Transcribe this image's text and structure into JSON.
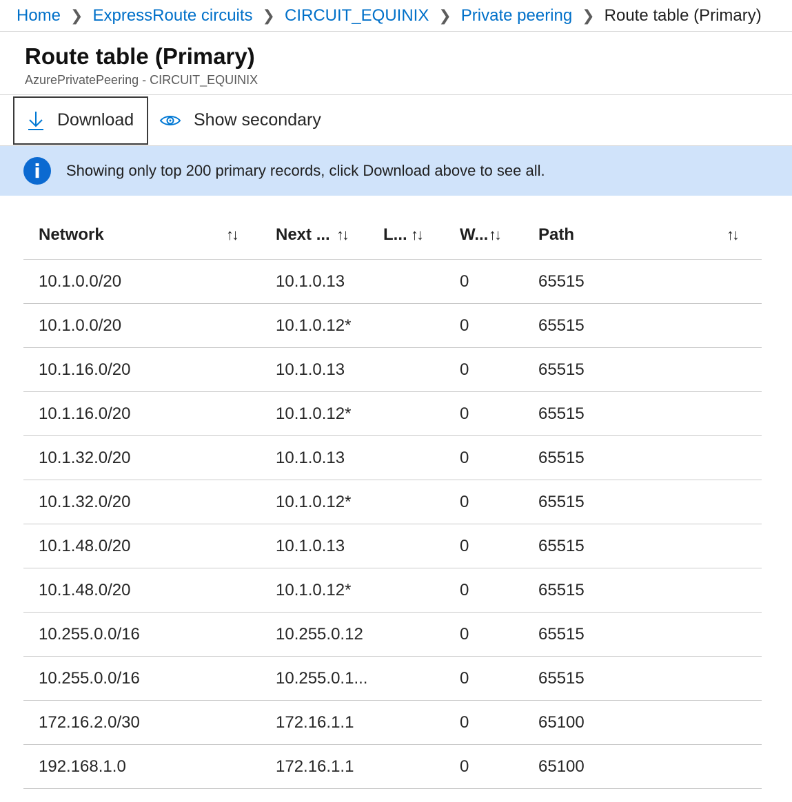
{
  "breadcrumb": {
    "items": [
      "Home",
      "ExpressRoute circuits",
      "CIRCUIT_EQUINIX",
      "Private peering"
    ],
    "current": "Route table (Primary)"
  },
  "header": {
    "title": "Route table (Primary)",
    "subtitle": "AzurePrivatePeering - CIRCUIT_EQUINIX"
  },
  "toolbar": {
    "download_label": "Download",
    "show_secondary_label": "Show secondary"
  },
  "infobar": {
    "message": "Showing only top 200 primary records, click Download above to see all."
  },
  "table": {
    "columns": {
      "network": "Network",
      "next_hop": "Next ...",
      "local_pref": "L...",
      "weight": "W...",
      "path": "Path"
    },
    "sort_glyph": "↑↓",
    "rows": [
      {
        "network": "10.1.0.0/20",
        "next_hop": "10.1.0.13",
        "local_pref": "",
        "weight": "0",
        "path": "65515"
      },
      {
        "network": "10.1.0.0/20",
        "next_hop": "10.1.0.12*",
        "local_pref": "",
        "weight": "0",
        "path": "65515"
      },
      {
        "network": "10.1.16.0/20",
        "next_hop": "10.1.0.13",
        "local_pref": "",
        "weight": "0",
        "path": "65515"
      },
      {
        "network": "10.1.16.0/20",
        "next_hop": "10.1.0.12*",
        "local_pref": "",
        "weight": "0",
        "path": "65515"
      },
      {
        "network": "10.1.32.0/20",
        "next_hop": "10.1.0.13",
        "local_pref": "",
        "weight": "0",
        "path": "65515"
      },
      {
        "network": "10.1.32.0/20",
        "next_hop": "10.1.0.12*",
        "local_pref": "",
        "weight": "0",
        "path": "65515"
      },
      {
        "network": "10.1.48.0/20",
        "next_hop": "10.1.0.13",
        "local_pref": "",
        "weight": "0",
        "path": "65515"
      },
      {
        "network": "10.1.48.0/20",
        "next_hop": "10.1.0.12*",
        "local_pref": "",
        "weight": "0",
        "path": "65515"
      },
      {
        "network": "10.255.0.0/16",
        "next_hop": "10.255.0.12",
        "local_pref": "",
        "weight": "0",
        "path": "65515"
      },
      {
        "network": "10.255.0.0/16",
        "next_hop": "10.255.0.1...",
        "local_pref": "",
        "weight": "0",
        "path": "65515"
      },
      {
        "network": "172.16.2.0/30",
        "next_hop": "172.16.1.1",
        "local_pref": "",
        "weight": "0",
        "path": "65100"
      },
      {
        "network": "192.168.1.0",
        "next_hop": "172.16.1.1",
        "local_pref": "",
        "weight": "0",
        "path": "65100"
      }
    ]
  },
  "icons": {
    "download": "download-icon",
    "show_secondary": "eye-icon",
    "info": "info-icon",
    "breadcrumb_separator": "chevron-right-icon"
  },
  "colors": {
    "link": "#0070c9",
    "info_bar": "#d0e3fa",
    "info_icon": "#0b6ad1",
    "accent": "#0078d4"
  }
}
